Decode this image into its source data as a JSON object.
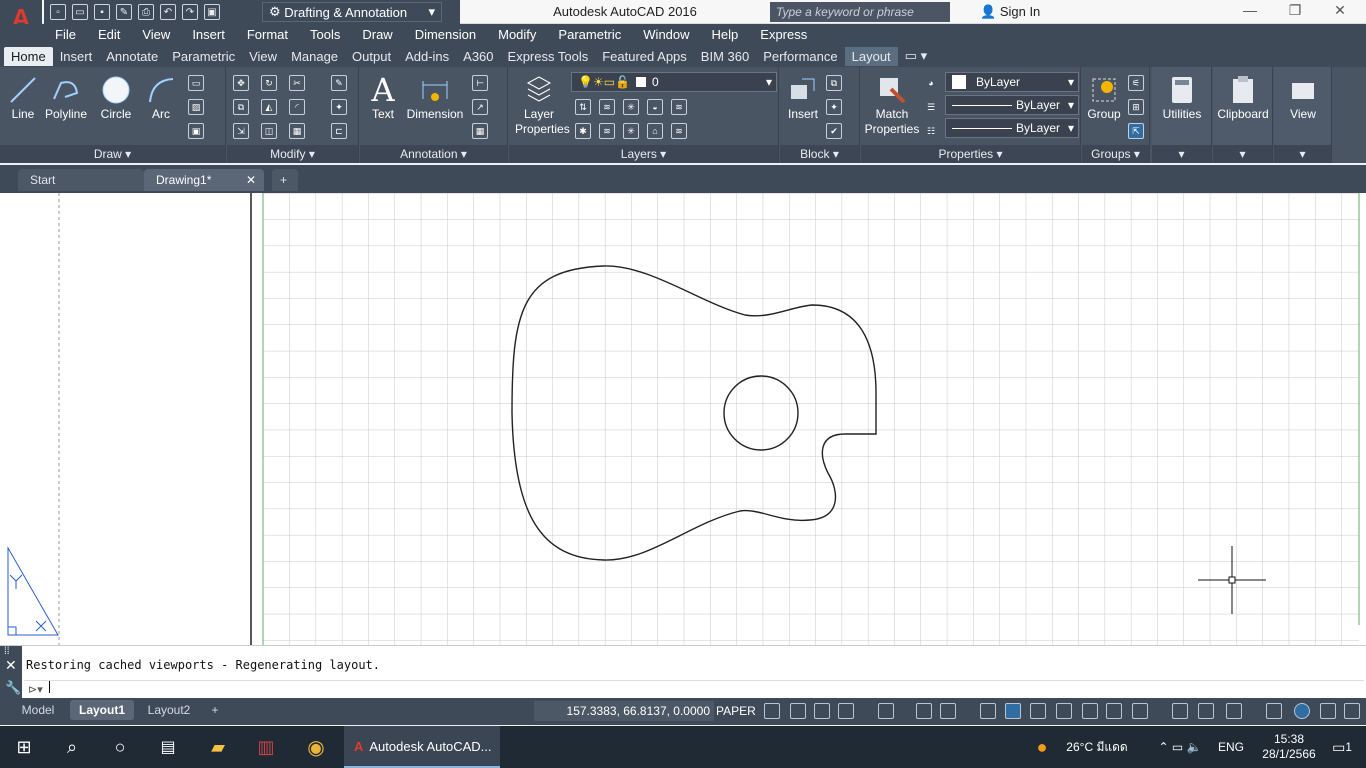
{
  "app": {
    "logo": "A",
    "window_title": "Autodesk AutoCAD 2016",
    "workspace": "Drafting & Annotation",
    "search_placeholder": "Type a keyword or phrase",
    "sign_in": "Sign In"
  },
  "menu": [
    "File",
    "Edit",
    "View",
    "Insert",
    "Format",
    "Tools",
    "Draw",
    "Dimension",
    "Modify",
    "Parametric",
    "Window",
    "Help",
    "Express"
  ],
  "ribbon_tabs": [
    "Home",
    "Insert",
    "Annotate",
    "Parametric",
    "View",
    "Manage",
    "Output",
    "Add-ins",
    "A360",
    "Express Tools",
    "Featured Apps",
    "BIM 360",
    "Performance",
    "Layout"
  ],
  "draw_panel": {
    "title": "Draw",
    "tools": [
      "Line",
      "Polyline",
      "Circle",
      "Arc"
    ]
  },
  "modify_panel": {
    "title": "Modify"
  },
  "annotation_panel": {
    "title": "Annotation",
    "tools": [
      "Text",
      "Dimension"
    ]
  },
  "layers_panel": {
    "title": "Layers",
    "layer_properties": "Layer\nProperties",
    "current_layer": "0"
  },
  "block_panel": {
    "title": "Block",
    "insert": "Insert"
  },
  "properties_panel": {
    "title": "Properties",
    "match": "Match\nProperties",
    "color": "ByLayer",
    "linetype": "ByLayer",
    "lineweight": "ByLayer"
  },
  "groups_panel": {
    "title": "Groups",
    "group": "Group"
  },
  "utilities": "Utilities",
  "clipboard": "Clipboard",
  "view": "View",
  "doc_tabs": [
    "Start",
    "Drawing1*"
  ],
  "command": {
    "history": "Restoring cached viewports - Regenerating layout."
  },
  "layout_tabs": [
    "Model",
    "Layout1",
    "Layout2"
  ],
  "status": {
    "coordinates": "157.3383, 66.8137, 0.0000",
    "space": "PAPER"
  },
  "taskbar": {
    "app": "Autodesk AutoCAD...",
    "weather": "26°C มีแดด",
    "lang": "ENG",
    "time": "15:38",
    "date": "28/1/2566",
    "notifications": "1"
  },
  "colors": {
    "dark": "#3f4a59",
    "ribbon": "#4a5563",
    "grid": "#c8c8c8"
  }
}
